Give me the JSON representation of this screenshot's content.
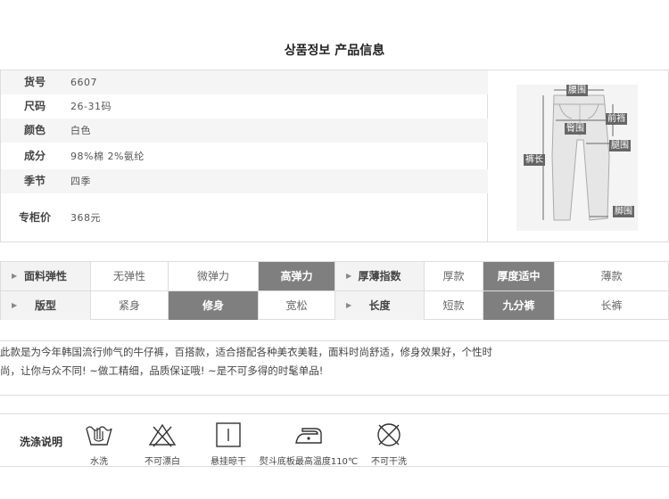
{
  "title": "상품정보 产品信息",
  "spec": [
    {
      "label": "货号",
      "value": "6607"
    },
    {
      "label": "尺码",
      "value": "26-31码"
    },
    {
      "label": "颜色",
      "value": "白色"
    },
    {
      "label": "成分",
      "value": "98%棉 2%氨纶"
    },
    {
      "label": "季节",
      "value": "四季"
    },
    {
      "label": "专柜价",
      "value": "368元"
    }
  ],
  "diagram_labels": {
    "waist": "腰围",
    "front_rise": "前裆",
    "hip": "臀围",
    "thigh": "腿围",
    "length": "裤长",
    "hem": "脚围"
  },
  "attributes": {
    "row1": {
      "elasticity_label": "面料弹性",
      "elasticity_options": [
        "无弹性",
        "微弹力",
        "高弹力"
      ],
      "elasticity_selected": "高弹力",
      "thickness_label": "厚薄指数",
      "thickness_options": [
        "厚款",
        "厚度适中",
        "薄款"
      ],
      "thickness_selected": "厚度适中"
    },
    "row2": {
      "fit_label": "版型",
      "fit_options": [
        "紧身",
        "修身",
        "宽松"
      ],
      "fit_selected": "修身",
      "length_label": "长度",
      "length_options": [
        "短款",
        "九分裤",
        "长裤"
      ],
      "length_selected": "九分裤"
    }
  },
  "description": {
    "line1": "此款是为今年韩国流行帅气的牛仔裤，百搭款，适合搭配各种美衣美鞋，面料时尚舒适，修身效果好，个性时",
    "line2": "尚，让你与众不同! ~做工精细，品质保证哦! ~是不可多得的时髦单品!"
  },
  "care": {
    "title": "洗涤说明",
    "items": [
      {
        "icon": "hand-wash-icon",
        "label": "水洗"
      },
      {
        "icon": "no-bleach-icon",
        "label": "不可漂白"
      },
      {
        "icon": "hang-dry-icon",
        "label": "悬挂晾干"
      },
      {
        "icon": "iron-icon",
        "label": "熨斗底板最高温度110℃"
      },
      {
        "icon": "no-dry-clean-icon",
        "label": "不可干洗"
      }
    ]
  }
}
